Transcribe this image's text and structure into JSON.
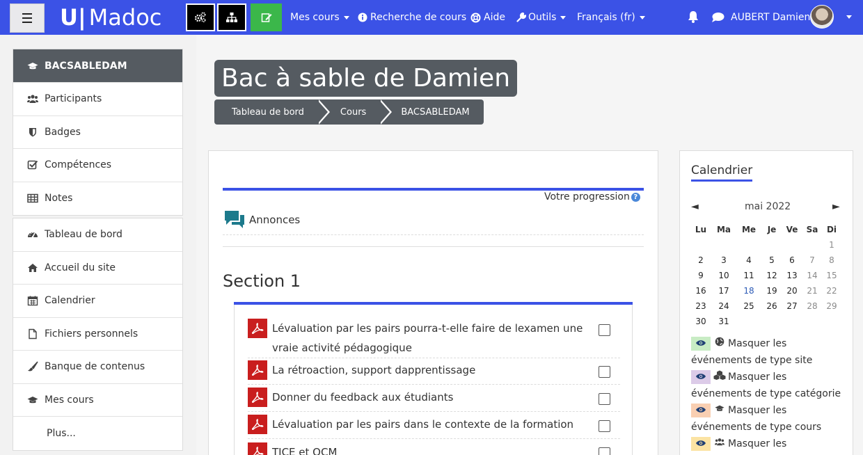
{
  "navbar": {
    "brand": "Madoc",
    "brand_mark": "ᑌ|",
    "menu": [
      {
        "label": "Mes cours",
        "caret": true
      },
      {
        "label": "Recherche de cours",
        "icon": "info-circle-icon"
      },
      {
        "label": "Aide",
        "icon": "lifebuoy-icon"
      },
      {
        "label": "Outils",
        "icon": "wrench-icon",
        "caret": true
      },
      {
        "label": "Français ‎(fr)‎",
        "caret": true
      }
    ],
    "user": "AUBERT Damien",
    "colors": {
      "bar": "#3b52e6",
      "edit": "#3bb74a"
    }
  },
  "drawer": {
    "course": "BACSABLEDAM",
    "course_items": [
      "Participants",
      "Badges",
      "Compétences",
      "Notes"
    ],
    "site_items": [
      "Tableau de bord",
      "Accueil du site",
      "Calendrier",
      "Fichiers personnels",
      "Banque de contenus",
      "Mes cours",
      "Plus..."
    ]
  },
  "header": {
    "title": "Bac à sable de Damien",
    "breadcrumb": [
      "Tableau de bord",
      "Cours",
      "BACSABLEDAM"
    ]
  },
  "course": {
    "progress_label": "Votre progression",
    "announcements": "Annonces",
    "section_title": "Section 1",
    "activities": [
      {
        "title": "Lévaluation par les pairs pourra-t-elle faire de lexamen une vraie activité pédagogique",
        "completed": false
      },
      {
        "title": "La rétroaction, support dapprentissage",
        "completed": false
      },
      {
        "title": "Donner du feedback aux étudiants",
        "completed": false
      },
      {
        "title": "Lévaluation par les pairs dans le contexte de la formation",
        "completed": false
      },
      {
        "title": "TICE et QCM",
        "completed": false
      }
    ]
  },
  "calendar": {
    "title": "Calendrier",
    "prev": "◄",
    "next": "►",
    "month": "mai 2022",
    "weekdays": [
      "Lu",
      "Ma",
      "Me",
      "Je",
      "Ve",
      "Sa",
      "Di"
    ],
    "weeks": [
      [
        "",
        "",
        "",
        "",
        "",
        "",
        "1"
      ],
      [
        "2",
        "3",
        "4",
        "5",
        "6",
        "7",
        "8"
      ],
      [
        "9",
        "10",
        "11",
        "12",
        "13",
        "14",
        "15"
      ],
      [
        "16",
        "17",
        "18",
        "19",
        "20",
        "21",
        "22"
      ],
      [
        "23",
        "24",
        "25",
        "26",
        "27",
        "28",
        "29"
      ],
      [
        "30",
        "31",
        "",
        "",
        "",
        "",
        ""
      ]
    ],
    "highlight_day": "18",
    "legend": [
      {
        "line1": "Masquer les",
        "line2": "événements de type site",
        "color": "#c8ecc4",
        "icon": "globe-icon"
      },
      {
        "line1": "Masquer les",
        "line2": "événements de type catégorie",
        "color": "#dccbe8",
        "icon": "cubes-icon"
      },
      {
        "line1": "Masquer les",
        "line2": "événements de type cours",
        "color": "#f9cfb2",
        "icon": "graduation-cap-icon"
      },
      {
        "line1": "Masquer les",
        "line2": "",
        "color": "#fbe3a3",
        "icon": "users-icon"
      }
    ]
  }
}
